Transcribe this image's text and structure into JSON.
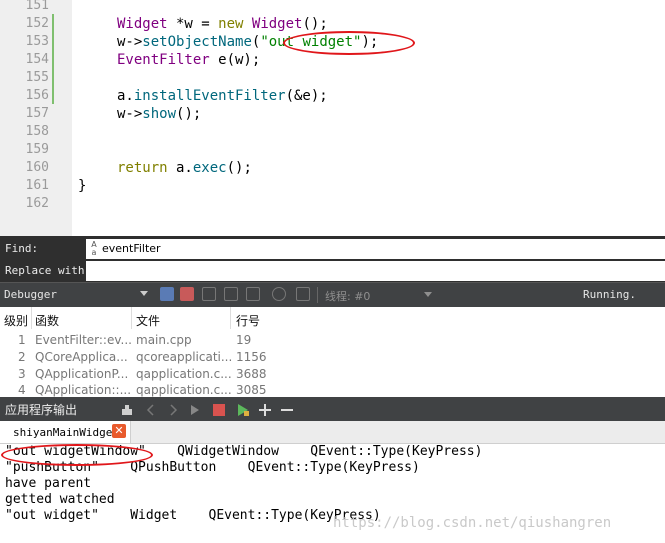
{
  "editor": {
    "lines": [
      {
        "num": "151"
      },
      {
        "num": "152"
      },
      {
        "num": "153"
      },
      {
        "num": "154"
      },
      {
        "num": "155"
      },
      {
        "num": "156"
      },
      {
        "num": "157"
      },
      {
        "num": "158"
      },
      {
        "num": "159"
      },
      {
        "num": "160"
      },
      {
        "num": "161"
      },
      {
        "num": "162"
      }
    ],
    "code": {
      "l152": {
        "type": "Widget",
        "decl": " *w = ",
        "kw": "new",
        "type2": "Widget",
        "end": "();"
      },
      "l153": {
        "obj": "w->",
        "fn": "setObjectName",
        "open": "(",
        "str": "\"out widget\"",
        "close": ");"
      },
      "l154": {
        "type": "EventFilter",
        "rest": " e(w);"
      },
      "l156": {
        "obj": "a.",
        "fn": "installEventFilter",
        "rest": "(&e);"
      },
      "l157": {
        "obj": "w->",
        "fn": "show",
        "rest": "();"
      },
      "l160": {
        "kw": "return",
        "obj": " a.",
        "fn": "exec",
        "rest": "();"
      },
      "l161": {
        "text": "}"
      }
    }
  },
  "find_bar": {
    "find_label": "Find:",
    "find_value": "eventFilter",
    "find_icon": "search-icon",
    "replace_label": "Replace with:",
    "replace_value": ""
  },
  "debugger_toolbar": {
    "combo_label": "Debugger",
    "thread_label": "线程: #0",
    "status": "Running."
  },
  "stack_table": {
    "headers": [
      "级别",
      "函数",
      "文件",
      "行号"
    ],
    "rows": [
      {
        "level": "1",
        "function": "EventFilter::ev...",
        "file": "main.cpp",
        "line": "19"
      },
      {
        "level": "2",
        "function": "QCoreApplica...",
        "file": "qcoreapplicati...",
        "line": "1156"
      },
      {
        "level": "3",
        "function": "QApplicationP...",
        "file": "qapplication.c...",
        "line": "3688"
      },
      {
        "level": "4",
        "function": "QApplication::...",
        "file": "qapplication.c...",
        "line": "3085"
      }
    ]
  },
  "output_pane": {
    "title": "应用程序输出",
    "tab_label": "shiyanMainWidget",
    "tab_close": "✕",
    "lines": [
      "\"out widgetWindow\"    QWidgetWindow    QEvent::Type(KeyPress)",
      "\"pushButton\"    QPushButton    QEvent::Type(KeyPress)",
      "have parent",
      "getted watched",
      "\"out widget\"    Widget    QEvent::Type(KeyPress)"
    ],
    "watermark": "https://blog.csdn.net/qiushangren"
  },
  "colors": {
    "keyword": "#808000",
    "type": "#800080",
    "function": "#00677c",
    "string": "#008000",
    "highlight_ellipse": "#e0161a",
    "dark_panel": "#404244"
  }
}
